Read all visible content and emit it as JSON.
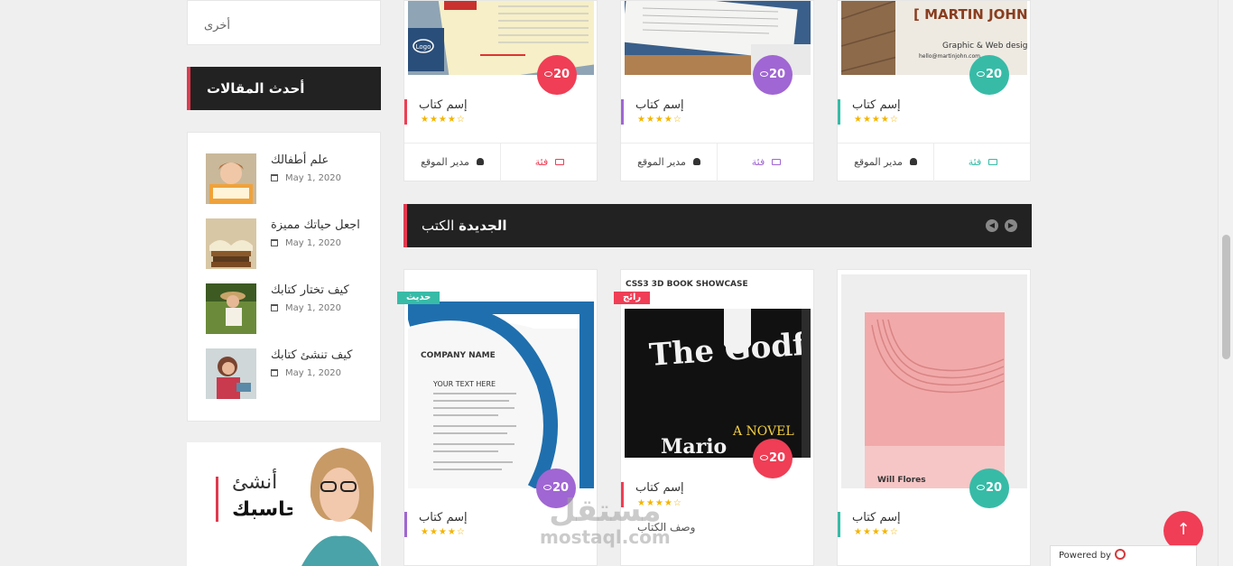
{
  "sidebar": {
    "other_category": "أخرى",
    "recent_title": "أحدث المقالات",
    "recent": [
      {
        "title": "علم أطفالك",
        "date": "May 1, 2020"
      },
      {
        "title": "اجعل حياتك مميزة",
        "date": "May 1, 2020"
      },
      {
        "title": "كيف تختار كتابك",
        "date": "May 1, 2020"
      },
      {
        "title": "كيف تنشئ كتابك",
        "date": "May 1, 2020"
      }
    ],
    "ad": {
      "line1": "أنشئ",
      "line2": "حاسبك"
    }
  },
  "top_cards": [
    {
      "views": "20",
      "title": "إسم كتاب",
      "stars": "★★★★☆",
      "author": "مدير الموقع",
      "category": "فئة",
      "color": "#ef3e55"
    },
    {
      "views": "20",
      "title": "إسم كتاب",
      "stars": "★★★★☆",
      "author": "مدير الموقع",
      "category": "فئة",
      "color": "#a066d3"
    },
    {
      "views": "20",
      "title": "إسم كتاب",
      "stars": "★★★★☆",
      "author": "مدير الموقع",
      "category": "فئة",
      "color": "#37bba7"
    }
  ],
  "section": {
    "title_bold": "الجديدة",
    "title_rest": "الكتب",
    "prev": "◀",
    "next": "▶"
  },
  "new_books": [
    {
      "views": "20",
      "title": "إسم كتاب",
      "stars": "★★★★☆",
      "ribbon": "حديث",
      "cover_company": "COMPANY NAME",
      "cover_text": "YOUR TEXT HERE",
      "color": "#a066d3",
      "ribbon_color": "#37bba7"
    },
    {
      "views": "20",
      "title": "إسم كتاب",
      "stars": "★★★★☆",
      "ribbon": "رائج",
      "desc": "وصف الكتاب",
      "header": "CSS3 3D BOOK SHOWCASE",
      "cover_title": "The Godfather",
      "cover_author": "Mario",
      "cover_sub": "A NOVEL",
      "color": "#ef3e55",
      "ribbon_color": "#ef3e55"
    },
    {
      "views": "20",
      "title": "إسم كتاب",
      "stars": "★★★★☆",
      "cover_author": "Will Flores",
      "color": "#37bba7"
    }
  ],
  "top_card_images": {
    "logo_text": "Logo",
    "business_card_name": "[ MARTIN JOHN",
    "business_card_role": "Graphic & Web design",
    "business_card_email": "hello@martinjohn.com"
  },
  "watermark": {
    "ar": "مستقل",
    "en": "mostaql.com"
  },
  "back_to_top": "↑",
  "powered": {
    "label": "Powered by",
    "brand": "000webhost"
  }
}
